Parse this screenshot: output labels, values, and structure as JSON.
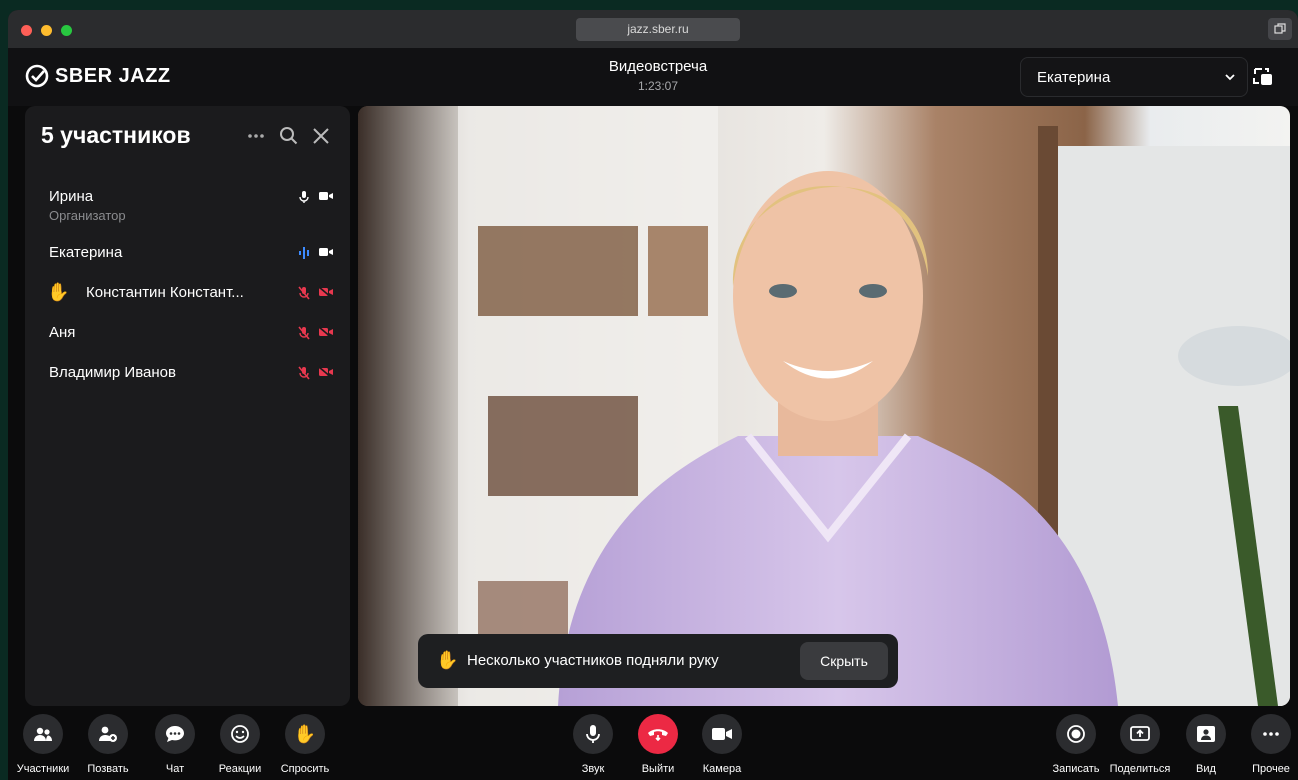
{
  "browser": {
    "url": "jazz.sber.ru"
  },
  "brand": {
    "name": "SBER JAZZ"
  },
  "meeting": {
    "title": "Видеовстреча",
    "timer": "1:23:07"
  },
  "user": {
    "name": "Екатерина"
  },
  "participants_panel": {
    "title": "5 участников",
    "items": [
      {
        "name": "Ирина",
        "role": "Организатор",
        "mic": "on",
        "cam": "on"
      },
      {
        "name": "Екатерина",
        "role": "",
        "mic": "speaking",
        "cam": "on"
      },
      {
        "name": "Константин Констант...",
        "role": "",
        "mic": "off",
        "cam": "off",
        "hand": true
      },
      {
        "name": "Аня",
        "role": "",
        "mic": "off",
        "cam": "off"
      },
      {
        "name": "Владимир Иванов",
        "role": "",
        "mic": "off",
        "cam": "off"
      }
    ]
  },
  "notification": {
    "text": "Несколько участников подняли руку",
    "hide_label": "Скрыть"
  },
  "toolbar": {
    "left": [
      {
        "label": "Участники",
        "icon": "participants-icon"
      },
      {
        "label": "Позвать",
        "icon": "invite-icon"
      },
      {
        "label": "Чат",
        "icon": "chat-icon"
      },
      {
        "label": "Реакции",
        "icon": "smile-icon"
      },
      {
        "label": "Спросить",
        "icon": "hand-icon"
      }
    ],
    "center": [
      {
        "label": "Звук",
        "icon": "mic-icon"
      },
      {
        "label": "Выйти",
        "icon": "hangup-icon"
      },
      {
        "label": "Камера",
        "icon": "camera-icon"
      }
    ],
    "right": [
      {
        "label": "Записать",
        "icon": "record-icon"
      },
      {
        "label": "Поделиться",
        "icon": "share-icon"
      },
      {
        "label": "Вид",
        "icon": "layout-icon"
      },
      {
        "label": "Прочее",
        "icon": "more-icon"
      }
    ]
  },
  "colors": {
    "accent_red": "#ec2944",
    "speaking_blue": "#3d8bff",
    "muted_red": "#e8384f",
    "panel_bg": "#1b1b1d"
  }
}
